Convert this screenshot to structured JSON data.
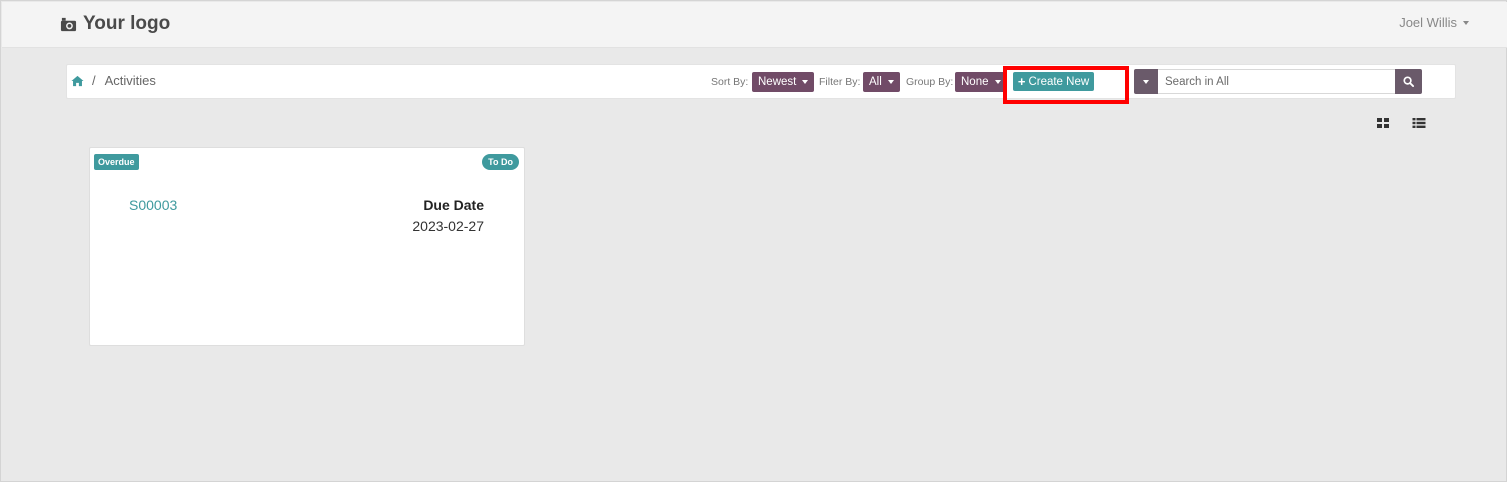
{
  "header": {
    "logo_text": "Your logo",
    "logo_icon": "camera-icon",
    "user_name": "Joel Willis"
  },
  "control_panel": {
    "breadcrumb": {
      "home_icon": "home-icon",
      "separator": "/",
      "current": "Activities"
    },
    "sort": {
      "label": "Sort By:",
      "value": "Newest"
    },
    "filter": {
      "label": "Filter By:",
      "value": "All"
    },
    "group": {
      "label": "Group By:",
      "value": "None"
    },
    "create_button": {
      "label": "Create New",
      "icon": "plus-icon"
    },
    "search": {
      "placeholder": "Search in All",
      "icon": "search-icon"
    }
  },
  "view_switcher": {
    "grid_icon": "grid-view-icon",
    "list_icon": "list-view-icon"
  },
  "cards": [
    {
      "status_badge": "Overdue",
      "stage_badge": "To Do",
      "reference": "S00003",
      "due_label": "Due Date",
      "due_value": "2023-02-27"
    }
  ],
  "colors": {
    "primary": "#714b67",
    "accent": "#3f9a9e",
    "highlight": "#ff0000",
    "background": "#e9e9e9"
  }
}
